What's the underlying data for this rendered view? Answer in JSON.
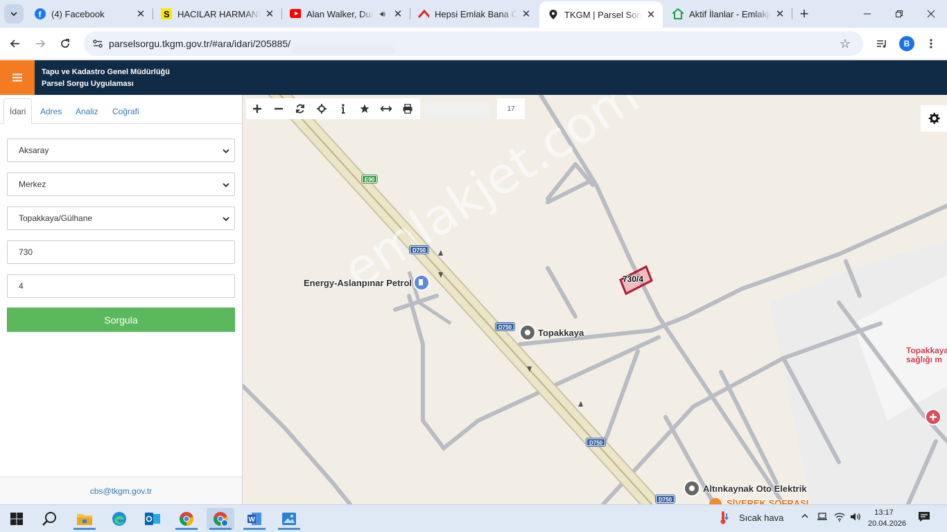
{
  "browser": {
    "tabs": [
      {
        "title": "(4) Facebook",
        "icon": "facebook-icon"
      },
      {
        "title": "HACILAR HARMANI",
        "icon": "sahibinden-icon"
      },
      {
        "title": "Alan Walker, Dua",
        "icon": "youtube-icon"
      },
      {
        "title": "Hepsi Emlak Bana Öz",
        "icon": "hepsiemlak-icon"
      },
      {
        "title": "TKGM | Parsel Sorgu",
        "icon": "location-pin-icon",
        "active": true
      },
      {
        "title": "Aktif İlanlar - Emlakje",
        "icon": "emlakjet-icon"
      }
    ],
    "url": "parselsorgu.tkgm.gov.tr/#ara/idari/205885/",
    "profile_initial": "B"
  },
  "app": {
    "title_line1": "Tapu ve Kadastro Genel Müdürlüğü",
    "title_line2": "Parsel Sorgu Uygulaması",
    "accent_color": "#f47b22",
    "header_color": "#0f2b45"
  },
  "panel": {
    "tabs": [
      "İdari",
      "Adres",
      "Analiz",
      "Coğrafi"
    ],
    "active_tab": "İdari",
    "il": "Aksaray",
    "ilce": "Merkez",
    "mahalle": "Topakkaya/Gülhane",
    "ada": "730",
    "parsel": "4",
    "submit_label": "Sorgula",
    "footer_email": "cbs@tkgm.gov.tr"
  },
  "map": {
    "zoom_level": "17",
    "parcel_label": "730/4",
    "watermark": "emlakjet.com",
    "pois": {
      "petrol": "Energy-Aslanpınar Petrol",
      "topakkaya": "Topakkaya",
      "oto": "Altınkaynak Oto Elektrik",
      "sofra": "SİVEREK SOFRASI",
      "saglik_line1": "Topakkaya",
      "saglik_line2": "sağlığı m"
    },
    "road_shields": {
      "e90": "E90",
      "d750_a": "D750",
      "d750_b": "D750",
      "d750_c": "D750",
      "d750_d": "D750"
    }
  },
  "taskbar": {
    "weather": "Sıcak hava",
    "time": "13:17",
    "date": "20.04.2026"
  }
}
